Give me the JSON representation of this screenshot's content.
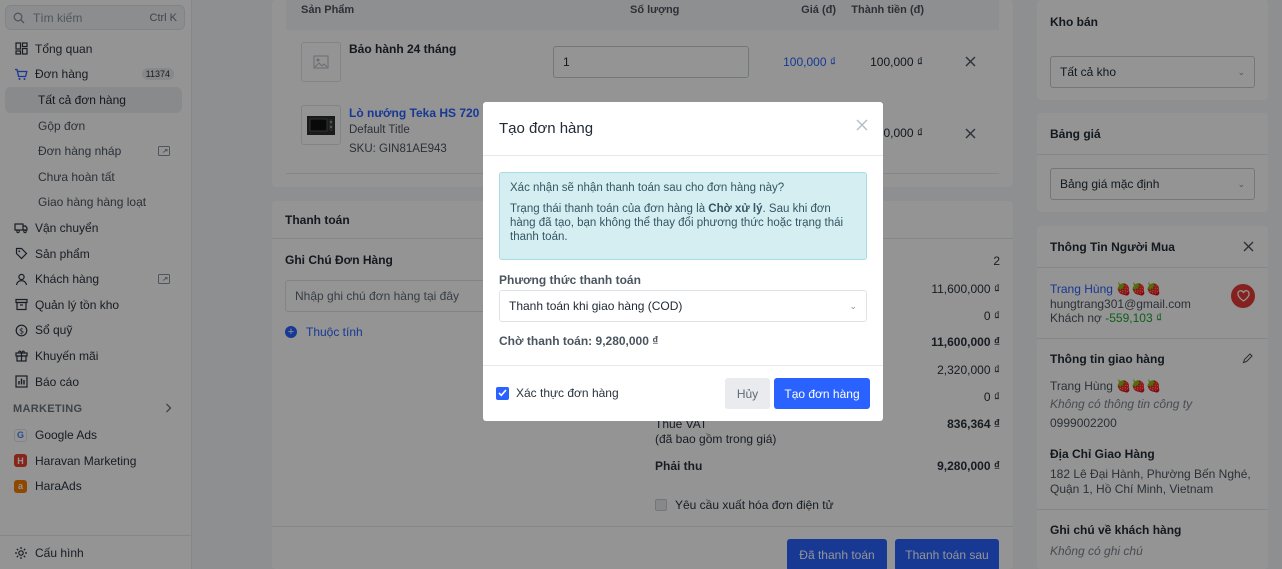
{
  "sidebar": {
    "search_placeholder": "Tìm kiếm",
    "search_shortcut": "Ctrl K",
    "items": [
      {
        "label": "Tổng quan"
      },
      {
        "label": "Đơn hàng",
        "badge": "11374"
      },
      {
        "label": "Tất cả đơn hàng"
      },
      {
        "label": "Gộp đơn"
      },
      {
        "label": "Đơn hàng nháp"
      },
      {
        "label": "Chưa hoàn tất"
      },
      {
        "label": "Giao hàng hàng loạt"
      },
      {
        "label": "Vận chuyển"
      },
      {
        "label": "Sản phẩm"
      },
      {
        "label": "Khách hàng"
      },
      {
        "label": "Quản lý tồn kho"
      },
      {
        "label": "Sổ quỹ"
      },
      {
        "label": "Khuyến mãi"
      },
      {
        "label": "Báo cáo"
      }
    ],
    "marketing_title": "MARKETING",
    "apps": [
      {
        "label": "Google Ads"
      },
      {
        "label": "Haravan Marketing"
      },
      {
        "label": "HaraAds"
      }
    ],
    "settings": "Cấu hình"
  },
  "products": {
    "headers": {
      "product": "Sản Phẩm",
      "qty": "Số lượng",
      "price": "Giá (đ)",
      "total": "Thành tiền (đ)"
    },
    "rows": [
      {
        "name": "Bảo hành 24 tháng",
        "qty": "1",
        "price": "100,000 ₫",
        "total": "100,000 ₫"
      },
      {
        "name": "Lò nướng Teka HS 720",
        "variant": "Default Title",
        "sku": "SKU: GIN81AE943",
        "total": "0,000 ₫"
      }
    ]
  },
  "payment": {
    "title": "Thanh toán",
    "note_title": "Ghi Chú Đơn Hàng",
    "note_placeholder": "Nhập ghi chú đơn hàng tại đây",
    "attributes_link": "Thuộc tính",
    "summary": [
      {
        "value": "2"
      },
      {
        "value": "11,600,000 ₫"
      },
      {
        "value": "0 ₫"
      },
      {
        "value": "11,600,000 ₫"
      },
      {
        "value": "2,320,000 ₫"
      },
      {
        "value": "0 ₫"
      }
    ],
    "vat_label": "Thuế VAT",
    "vat_sub": "(đã bao gồm trong giá)",
    "vat_value": "836,364 ₫",
    "receivable_label": "Phải thu",
    "receivable_value": "9,280,000 ₫",
    "invoice_label": "Yêu cầu xuất hóa đơn điện tử",
    "btn_paid": "Đã thanh toán",
    "btn_pay_later": "Thanh toán sau"
  },
  "right": {
    "warehouse_title": "Kho bán",
    "warehouse_value": "Tất cả kho",
    "pricebook_title": "Bảng giá",
    "pricebook_value": "Bảng giá mặc định",
    "buyer_title": "Thông Tin Người Mua",
    "buyer_name": "Trang Hùng 🍓🍓🍓",
    "buyer_email": "hungtrang301@gmail.com",
    "debt_label": "Khách nợ",
    "debt_value": "-559,103 ₫",
    "shipping_title": "Thông tin giao hàng",
    "shipping_name": "Trang Hùng 🍓🍓🍓",
    "shipping_company": "Không có thông tin công ty",
    "shipping_phone": "0999002200",
    "address_title": "Địa Chỉ Giao Hàng",
    "address_line1": "182 Lê Đại Hành, Phường Bến Nghé,",
    "address_line2": "Quận 1, Hồ Chí Minh, Vietnam",
    "customer_note_title": "Ghi chú về khách hàng",
    "customer_note": "Không có ghi chú"
  },
  "modal": {
    "title": "Tạo đơn hàng",
    "alert_line1": "Xác nhận sẽ nhận thanh toán sau cho đơn hàng này?",
    "alert_line2_pre": "Trạng thái thanh toán của đơn hàng là ",
    "alert_line2_bold": "Chờ xử lý",
    "alert_line2_post": ". Sau khi đơn hàng đã tạo, bạn không thể thay đổi phương thức hoặc trạng thái thanh toán.",
    "payment_method_label": "Phương thức thanh toán",
    "payment_method_value": "Thanh toán khi giao hàng (COD)",
    "awaiting": "Chờ thanh toán: 9,280,000 ₫",
    "verify_label": "Xác thực đơn hàng",
    "cancel": "Hủy",
    "create": "Tạo đơn hàng"
  },
  "colors": {
    "primary": "#2962ff",
    "alert_bg": "#d5eef2",
    "debt": "#1aa32f",
    "heart": "#e53935"
  },
  "icons": [
    "search-icon",
    "dashboard-icon",
    "cart-icon",
    "truck-icon",
    "tag-icon",
    "user-icon",
    "inventory-icon",
    "cash-icon",
    "gift-icon",
    "chart-icon",
    "gear-icon",
    "close-icon",
    "heart-icon",
    "pencil-icon",
    "image-icon",
    "external-link-icon",
    "chevron-right-icon"
  ]
}
